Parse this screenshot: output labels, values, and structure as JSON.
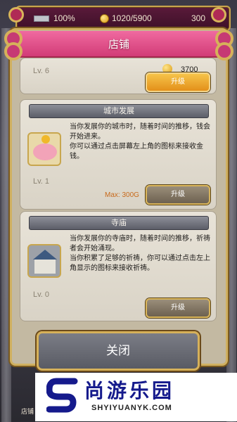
{
  "topbar": {
    "health_percent": "100%",
    "coins": "1020/5900",
    "points": "300"
  },
  "dialog": {
    "title": "店铺"
  },
  "cards": [
    {
      "level": "Lv. 6",
      "price": "3700",
      "button": "升级"
    },
    {
      "title": "城市发展",
      "description": "当你发展你的城市时，随着时间的推移，钱会开始进来。\n你可以通过点击屏幕左上角的图标来接收金钱。",
      "level": "Lv. 1",
      "max": "Max: 300G",
      "button": "升级"
    },
    {
      "title": "寺庙",
      "description": "当你发展你的寺庙时，随着时间的推移，祈祷者会开始涌现。\n当你积累了足够的祈祷，你可以通过点击左上角显示的图标来接收祈祷。",
      "level": "Lv. 0",
      "button": "升级"
    }
  ],
  "close_button": "关闭",
  "bottom_tab": "店铺",
  "watermark": {
    "name": "尚游乐园",
    "url": "SHYIYUANYK.COM"
  },
  "colors": {
    "title_pink": "#e0508a",
    "gold_border": "#d6b15a",
    "watermark_blue": "#151a8c"
  }
}
